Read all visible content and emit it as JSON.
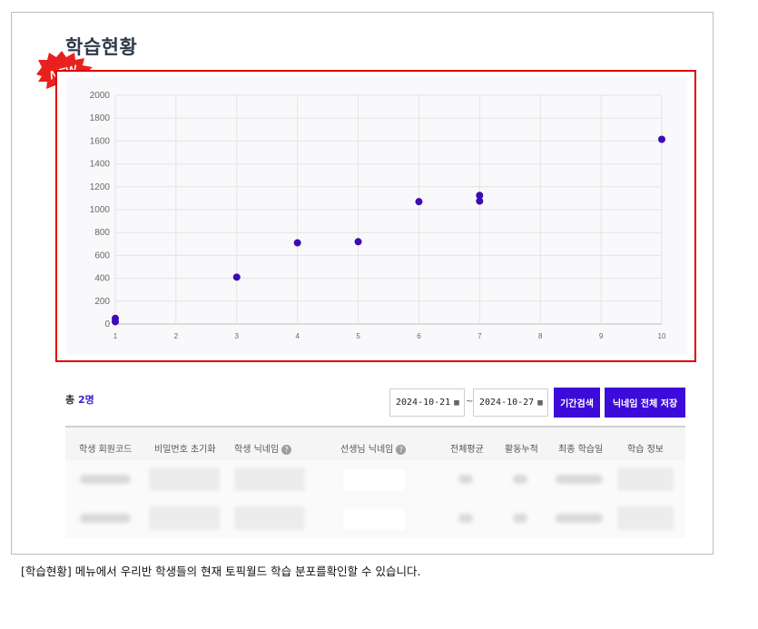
{
  "page_title": "학습현황",
  "new_badge": "NEW",
  "chart_data": {
    "type": "scatter",
    "xlim": [
      1,
      10
    ],
    "ylim": [
      0,
      2000
    ],
    "x_ticks": [
      1,
      2,
      3,
      4,
      5,
      6,
      7,
      8,
      9,
      10
    ],
    "y_ticks": [
      0,
      200,
      400,
      600,
      800,
      1000,
      1200,
      1400,
      1600,
      1800,
      2000
    ],
    "grid": true,
    "point_color": "#3d0bb5",
    "points": [
      {
        "x": 1,
        "y": 50
      },
      {
        "x": 1,
        "y": 20
      },
      {
        "x": 3,
        "y": 410
      },
      {
        "x": 4,
        "y": 710
      },
      {
        "x": 5,
        "y": 720
      },
      {
        "x": 6,
        "y": 1070
      },
      {
        "x": 7,
        "y": 1125
      },
      {
        "x": 7,
        "y": 1075
      },
      {
        "x": 10,
        "y": 1615
      }
    ]
  },
  "toolbar": {
    "total_prefix": "총",
    "total_count": "2명",
    "start_date": "2024-10-21",
    "end_date": "2024-10-27",
    "separator": "~",
    "search_button": "기간검색",
    "save_nickname_button": "닉네임 전체 저장"
  },
  "table": {
    "headers": [
      "학생 회원코드",
      "비밀번호 초기화",
      "학생 닉네임",
      "선생님 닉네임",
      "전체평균",
      "활동누적",
      "최종 학습일",
      "학습 정보"
    ],
    "help_icon": "?",
    "rows_blurred": 2
  },
  "caption": "[학습현황] 메뉴에서 우리반 학생들의 현재 토픽월드 학습 분포를확인할 수 있습니다.",
  "colors": {
    "accent": "#3d0bd9",
    "highlight_border": "#e00000",
    "badge": "#e8211f"
  }
}
